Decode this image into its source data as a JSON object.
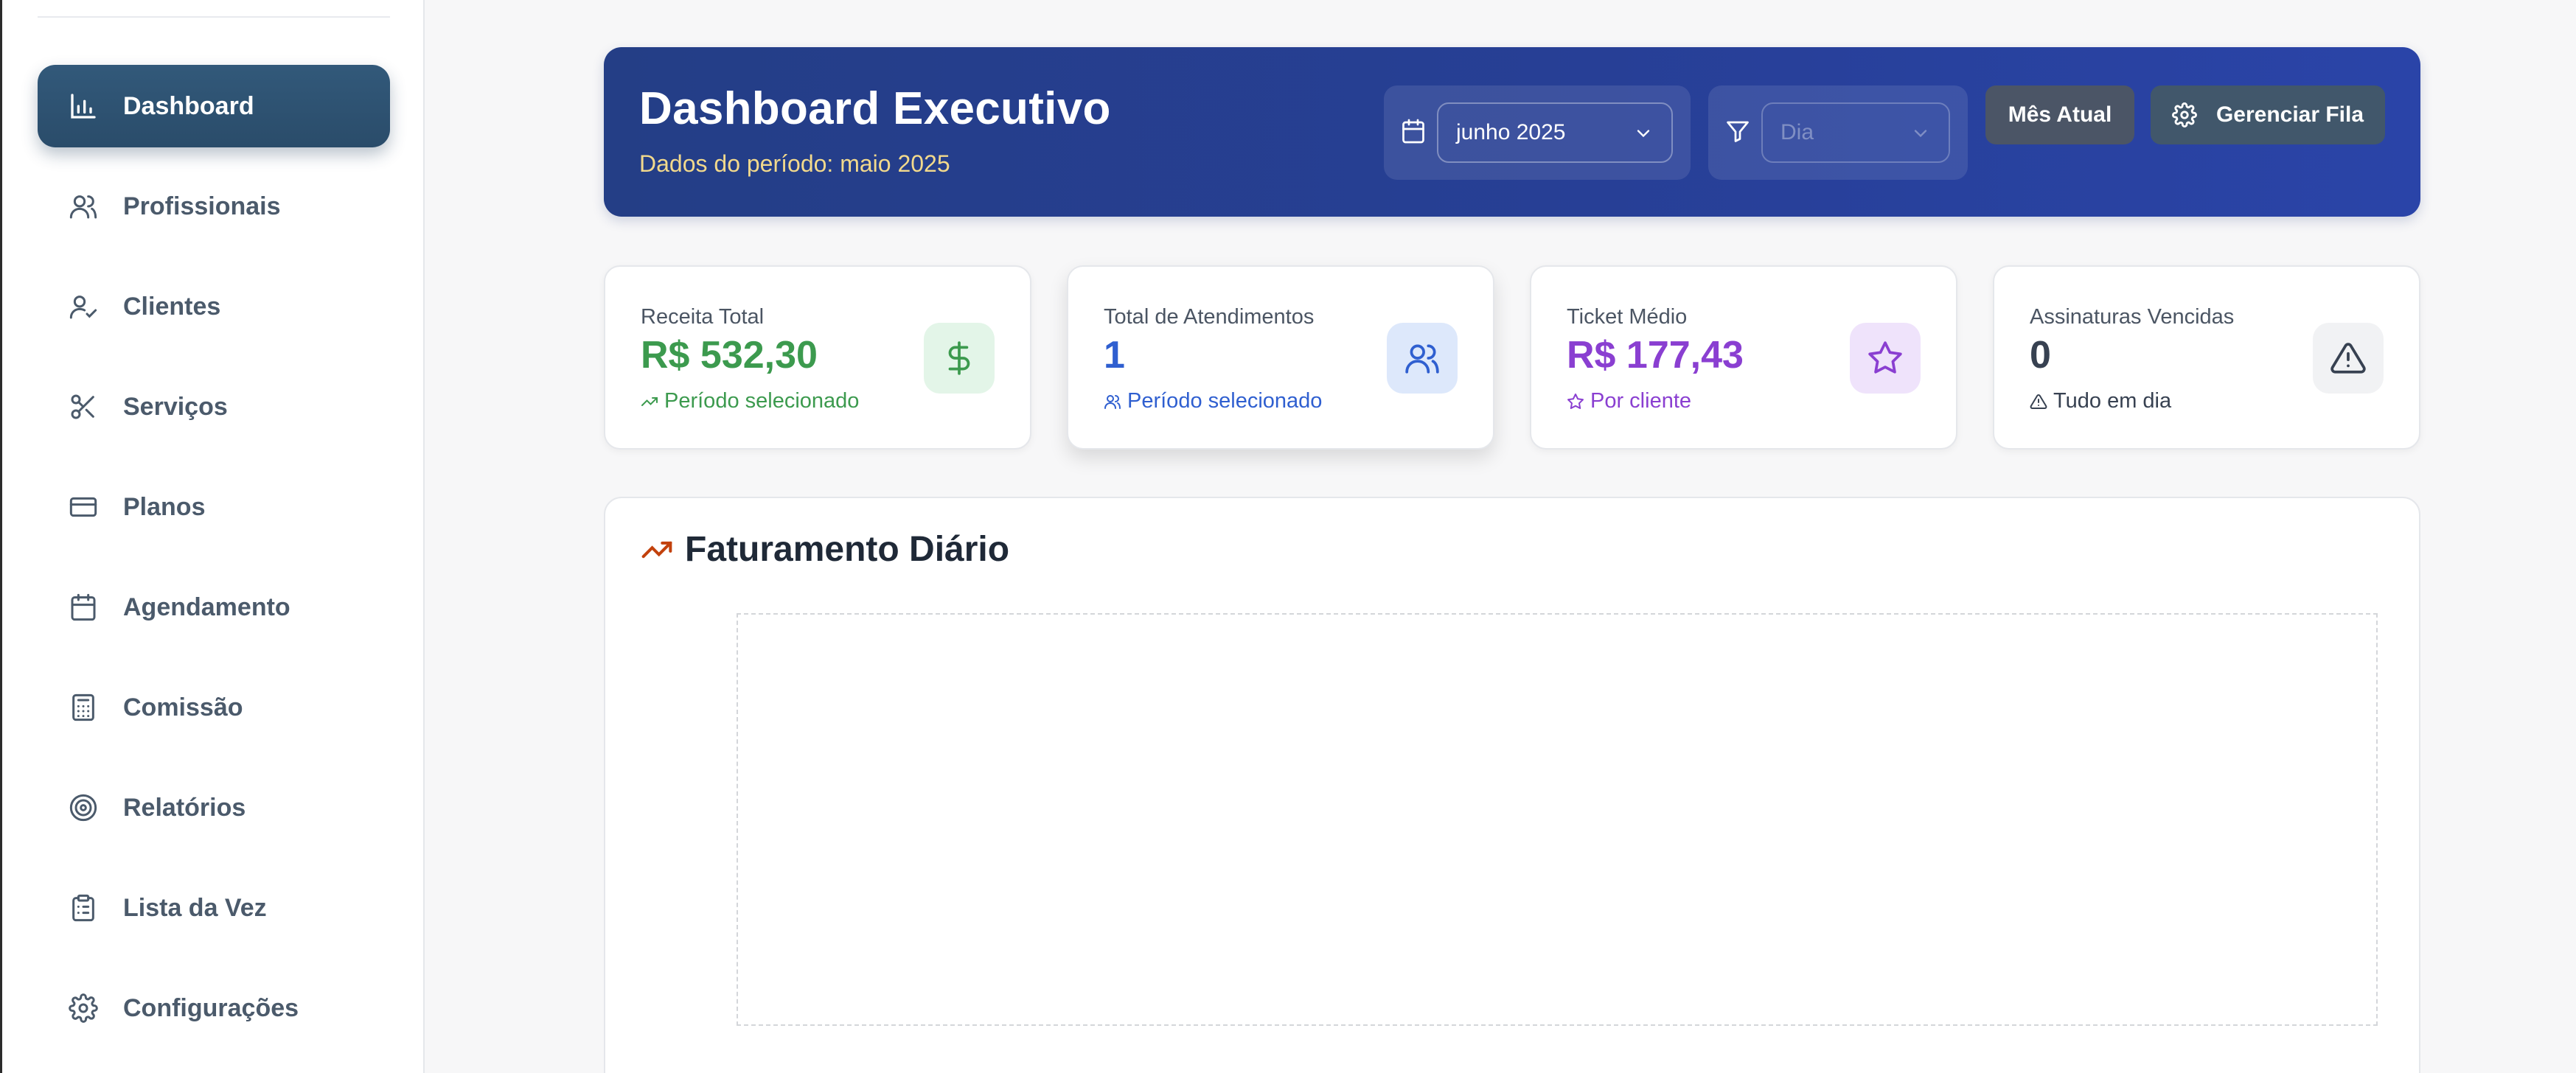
{
  "sidebar": {
    "items": [
      {
        "label": "Dashboard",
        "icon": "bar-chart-icon",
        "active": true
      },
      {
        "label": "Profissionais",
        "icon": "users-icon"
      },
      {
        "label": "Clientes",
        "icon": "user-check-icon"
      },
      {
        "label": "Serviços",
        "icon": "scissors-icon"
      },
      {
        "label": "Planos",
        "icon": "credit-card-icon"
      },
      {
        "label": "Agendamento",
        "icon": "calendar-icon"
      },
      {
        "label": "Comissão",
        "icon": "calculator-icon"
      },
      {
        "label": "Relatórios",
        "icon": "target-icon"
      },
      {
        "label": "Lista da Vez",
        "icon": "clipboard-list-icon"
      },
      {
        "label": "Configurações",
        "icon": "gear-icon"
      }
    ]
  },
  "header": {
    "title": "Dashboard Executivo",
    "subtitle": "Dados do período: maio 2025",
    "month_select": {
      "value": "junho 2025",
      "icon": "calendar-icon"
    },
    "day_select": {
      "placeholder": "Dia",
      "icon": "filter-icon"
    },
    "current_month_button": "Mês Atual",
    "manage_queue_button": "Gerenciar Fila"
  },
  "cards": [
    {
      "label": "Receita Total",
      "value": "R$ 532,30",
      "note": "Período selecionado",
      "icon": "dollar-icon",
      "color": "#3c9a4e",
      "badge_bg": "#e3f5e8"
    },
    {
      "label": "Total de Atendimentos",
      "value": "1",
      "note": "Período selecionado",
      "icon": "users-icon",
      "color": "#2f5fd0",
      "badge_bg": "#dde8fb"
    },
    {
      "label": "Ticket Médio",
      "value": "R$ 177,43",
      "note": "Por cliente",
      "icon": "star-icon",
      "color": "#8a3fd1",
      "badge_bg": "#efe3fb"
    },
    {
      "label": "Assinaturas Vencidas",
      "value": "0",
      "note": "Tudo em dia",
      "icon": "alert-triangle-icon",
      "color": "#374151",
      "badge_bg": "#f1f2f4"
    }
  ],
  "chart_section": {
    "title": "Faturamento Diário",
    "icon": "trending-up-icon"
  },
  "colors": {
    "sidebar_active": "#2e5272",
    "banner": "#263f92",
    "subtitle": "#f2d98c"
  }
}
